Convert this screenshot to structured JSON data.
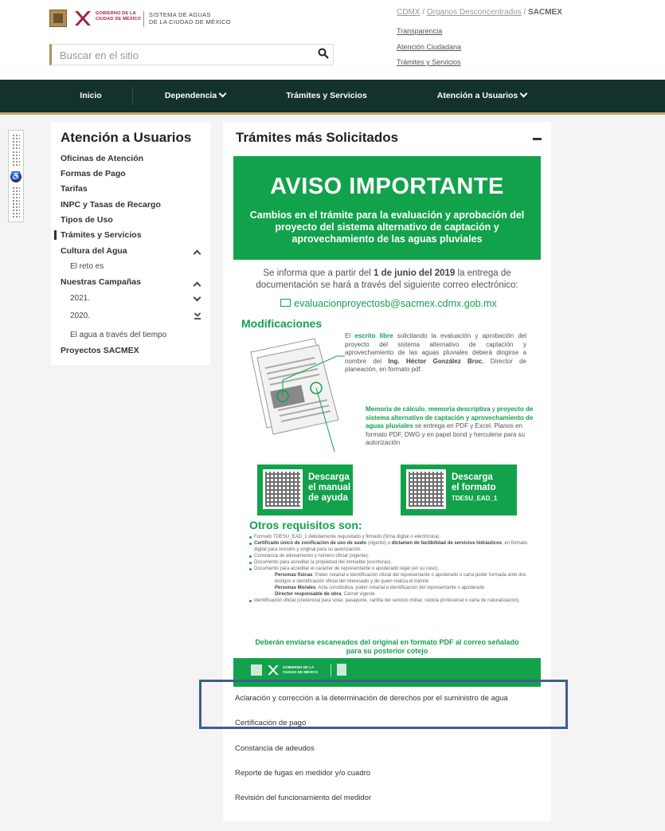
{
  "header": {
    "gov_text": [
      "GOBIERNO DE LA",
      "CIUDAD DE MÉXICO"
    ],
    "org_text": [
      "SISTEMA DE AGUAS",
      "DE LA CIUDAD DE MÉXICO"
    ],
    "search_placeholder": "Buscar en el sitio",
    "breadcrumb": {
      "first": "CDMX",
      "sep1": " / ",
      "second": "Organos Desconcentrados",
      "sep2": " / ",
      "current": "SACMEX"
    },
    "links": [
      "Transparencia",
      "Atención Ciudadana",
      "Trámites y Servicios"
    ]
  },
  "nav": {
    "items": [
      "Inicio",
      "Dependencia",
      "Trámites y Servicios",
      "Atención a Usuarios"
    ]
  },
  "sidebar": {
    "title": "Atención a Usuarios",
    "items": [
      "Oficinas de Atención",
      "Formas de Pago",
      "Tarifas",
      "INPC y Tasas de Recargo",
      "Tipos de Uso",
      "Trámites y Servicios",
      "Cultura del Agua",
      "El reto es",
      "Nuestras Campañas",
      "2021.",
      "2020.",
      "El agua a través del tiempo",
      "Proyectos SACMEX"
    ]
  },
  "main": {
    "title": "Trámites más Solicitados",
    "notice": {
      "heading": "AVISO IMPORTANTE",
      "subheading": "Cambios en el trámite para la evaluación y aprobación del proyecto del sistema alternativo de captación y aprovechamiento de las aguas pluviales",
      "intro_a": "Se informa que a partir del ",
      "intro_date": "1 de junio del 2019",
      "intro_b": " la entrega de documentación se hará a través del siguiente correo electrónico:",
      "email": "evaluacionproyectosb@sacmex.cdmx.gob.mx",
      "modificaciones": "Modificaciones",
      "p1_a": "El ",
      "p1_b": "escrito libre",
      "p1_c": " solicitando la evaluación y aprobación del proyecto del sistema alternativo de captación y aprovechamiento de las aguas pluviales deberá dirigirse a nombre del ",
      "p1_d": "Ing. Héctor González Broc",
      "p1_e": ", Director de planeación, en formato pdf.",
      "p2_a": "Memoria de cálculo",
      "p2_b": ", ",
      "p2_c": "memoria descriptiva",
      "p2_d": " y ",
      "p2_e": "proyecto de sistema alternativo de captación y aprovechamiento de aguas pluviales",
      "p2_f": " se entrega en PDF y Excel. Planos en formato PDF, DWG y en papel bond y herculene para su autorización",
      "download1": [
        "Descarga",
        "el manual",
        "de ayuda"
      ],
      "download2": [
        "Descarga",
        "el formato",
        "TDESU_EAD_1"
      ],
      "otros": "Otros requisitos son:",
      "req1": "Formato TDESU_EAD_1 debidamente requisitado y firmado (firma digital o electrónica).",
      "req2_b1": "Certificado único de zonificación de uso de suelo",
      "req2_m": " (vigente) o ",
      "req2_b2": "dictamen de factibilidad de servicios hidráulicos",
      "req2_e": "; en formato digital para revisión y original para su autorización.",
      "req3": "Constancia de alineamiento y número oficial (vigente).",
      "req4": "Documento para acreditar la propiedad del inmueble (escrituras).",
      "req5": "Documento para acreditar el carácter de representante o apoderado legal (en su caso).",
      "req5a_b": "Personas físicas",
      "req5a": ": Poder notarial e identificación oficial del representante o apoderado o carta poder formada ante dos testigos e identificación oficial del interesado y de quien realiza el trámite",
      "req5b_b": "Personas Morales",
      "req5b": ": Acta constitutiva, poder notarial e identificación del representante o apoderado",
      "req5c_b": "Director responsable de obra",
      "req5c": ": Carnet vigente",
      "req6": "Identificación oficial (credencial para votar, pasaporte, cartilla del servicio militar, cédula profesional o carta de naturalización).",
      "closing": "Deberán enviarse escaneados del original en formato PDF al correo señalado para su posterior cotejo",
      "footer_gov": [
        "GOBIERNO DE LA",
        "CIUDAD DE MÉXICO"
      ]
    },
    "list": [
      "Aclaración y corrección a la determinación de derechos por el suministro de agua",
      "Certificación de pago",
      "Constancia de adeudos",
      "Reporte de fugas en medidor y/o cuadro",
      "Revisión del funcionamiento del medidor"
    ]
  },
  "colors": {
    "nav_bg": "#13322b",
    "nav_border": "#c2a46d",
    "notice_green": "#13a24c",
    "highlight": "#3c5f90",
    "gov_red": "#9f2241"
  }
}
